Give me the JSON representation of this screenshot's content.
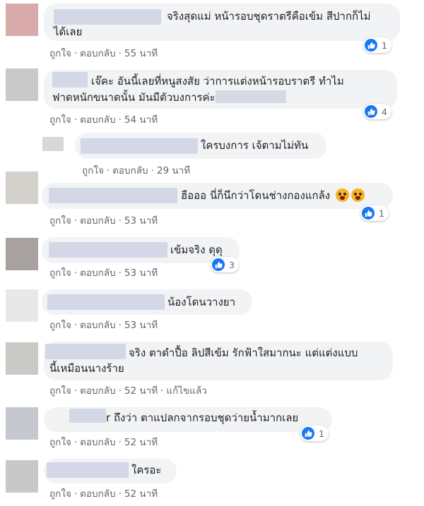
{
  "actions": {
    "like": "ถูกใจ",
    "reply": "ตอบกลับ",
    "edited": "แก้ไขแล้ว",
    "separator": "·"
  },
  "comments": [
    {
      "text_lines": [
        "จริงสุดแม่ หน้ารอบชุดราตรีคือเข้ม สีปากก็ไม่",
        "ได้เลย"
      ],
      "time": "55 นาที",
      "reactions": "1"
    },
    {
      "text_lines": [
        "เจ๊คะ อันนี้เลยที่หนูสงสัย ว่าการแต่งหน้ารอบราตรี ทำไม",
        "ฟาดหนักขนาดนั้น มันมีตัวบงการค่ะ"
      ],
      "time": "54 นาที",
      "reactions": "4"
    },
    {
      "text": "ใครบงการ เจ้ตามไม่ทัน",
      "time": "29 นาที"
    },
    {
      "text": "ฮือออ นี่ก็นึกว่าโดนช่างกองแกล้ง",
      "time": "53 นาที",
      "reactions": "1",
      "emoji": [
        "crying-face",
        "crying-face"
      ]
    },
    {
      "text": "เข้มจริง ดุดุ",
      "time": "53 นาที",
      "reactions": "3"
    },
    {
      "text": "น้องโดนวางยา",
      "time": "53 นาที"
    },
    {
      "text_lines": [
        "จริง ตาดำปื้อ ลิปสีเข้ม รักฟ้าใสมากนะ แต่แต่งแบบ",
        "นี้เหมือนนางร้าย"
      ],
      "time": "52 นาที",
      "edited": true
    },
    {
      "text": "ถึงว่า ตาแปลกจากรอบชุดว่ายน้ำมากเลย",
      "name_tail": "r",
      "time": "52 นาที",
      "reactions": "1"
    },
    {
      "text": "ใครอะ",
      "time": "52 นาที"
    }
  ],
  "colors": {
    "bubble": "#f2f3f5",
    "meta": "#606770",
    "like": "#1877f2",
    "text": "#1c1e21"
  }
}
